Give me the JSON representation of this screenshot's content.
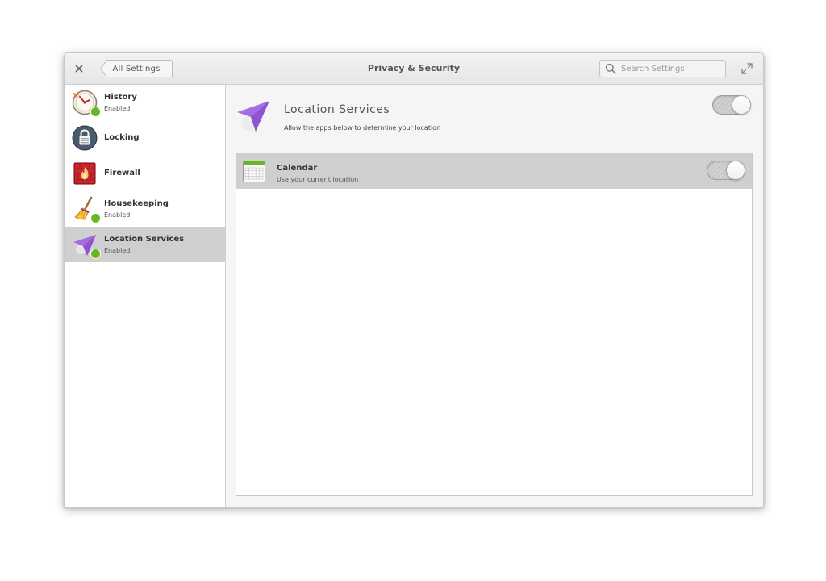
{
  "window": {
    "title": "Privacy & Security"
  },
  "header": {
    "back_label": "All Settings",
    "search_placeholder": "Search Settings"
  },
  "sidebar": {
    "items": [
      {
        "name": "History",
        "status": "Enabled",
        "icon": "history-icon",
        "has_status": true
      },
      {
        "name": "Locking",
        "status": "",
        "icon": "lock-icon",
        "has_status": false
      },
      {
        "name": "Firewall",
        "status": "",
        "icon": "firewall-icon",
        "has_status": false
      },
      {
        "name": "Housekeeping",
        "status": "Enabled",
        "icon": "broom-icon",
        "has_status": true
      },
      {
        "name": "Location Services",
        "status": "Enabled",
        "icon": "location-arrow-icon",
        "has_status": true
      }
    ]
  },
  "main": {
    "title": "Location Services",
    "description": "Allow the apps below to determine your location",
    "enabled": true,
    "apps": [
      {
        "name": "Calendar",
        "description": "Use your current location",
        "icon": "calendar-icon",
        "enabled": true
      }
    ]
  },
  "colors": {
    "accent_purple": "#a56de2",
    "status_green": "#68b723",
    "selected_row": "#cfcfcf"
  }
}
